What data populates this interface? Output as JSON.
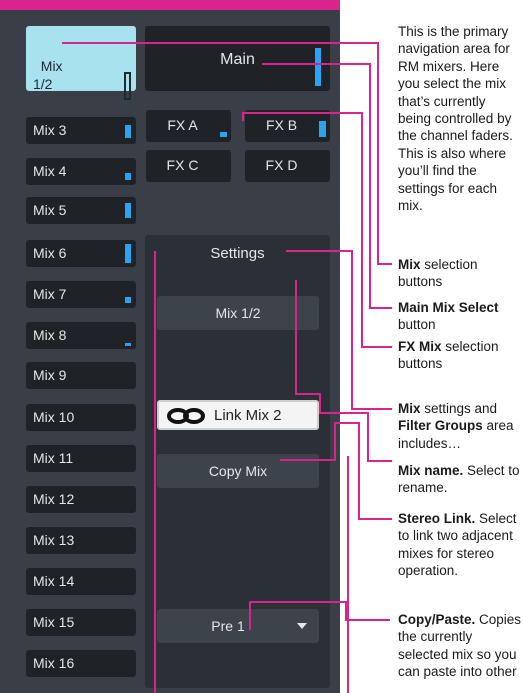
{
  "mix_buttons": [
    "Mix\n1/2",
    "Mix 3",
    "Mix 4",
    "Mix 5",
    "Mix 6",
    "Mix 7",
    "Mix 8",
    "Mix 9",
    "Mix 10",
    "Mix 11",
    "Mix 12",
    "Mix 13",
    "Mix 14",
    "Mix 15",
    "Mix 16"
  ],
  "main_label": "Main",
  "fx_buttons": [
    "FX A",
    "FX B",
    "FX C",
    "FX D"
  ],
  "settings_title": "Settings",
  "mix_name_button": "Mix 1/2",
  "link_button": "Link Mix 2",
  "copy_button": "Copy Mix",
  "pre_select": "Pre 1",
  "annotations": {
    "intro": "This is the primary navigation area for RM mixers. Here you select the mix that’s currently being controlled by the channel faders. This is also where you’ll find the settings for each mix.",
    "mix_sel_bold": "Mix",
    "mix_sel_rest": " selection buttons",
    "main_bold": "Main Mix Select",
    "main_rest": " button",
    "fx_bold": "FX Mix",
    "fx_rest": " selection buttons",
    "settings_bold1": "Mix",
    "settings_mid": " settings and ",
    "settings_bold2": "Filter Groups",
    "settings_rest": " area includes…",
    "name_bold": "Mix name.",
    "name_rest": " Select to rename.",
    "stereo_bold": "Stereo Link.",
    "stereo_rest": " Select to link two adjacent mixes for stereo operation.",
    "copy_bold": "Copy/Paste.",
    "copy_rest": " Copies the currently selected mix so you can paste into other"
  },
  "colors": {
    "accent": "#d8248b",
    "meter": "#29a3f2",
    "selected": "#a9e2ef"
  }
}
